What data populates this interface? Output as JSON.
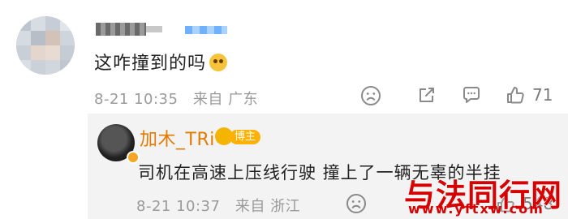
{
  "comment_top": {
    "text": "这咋撞到的吗",
    "emoji_icon": "crying-laughing-emoji-icon",
    "time": "8-21 10:35",
    "location": "来自 广东",
    "likes": "71"
  },
  "reply": {
    "author": "加木_TRi",
    "role_tag": "博主",
    "text": "司机在高速上压线行驶 撞上了一辆无辜的半挂",
    "time": "8-21 10:37",
    "location": "来自 浙江",
    "likes": "548"
  },
  "watermark": {
    "title": "与法同行网",
    "url": "www.yftxw.com"
  },
  "colors": {
    "author_orange": "#e27b00",
    "meta_gray": "#9a9a9a",
    "reply_bg": "#f3f3f3",
    "watermark_red": "#d60000"
  }
}
